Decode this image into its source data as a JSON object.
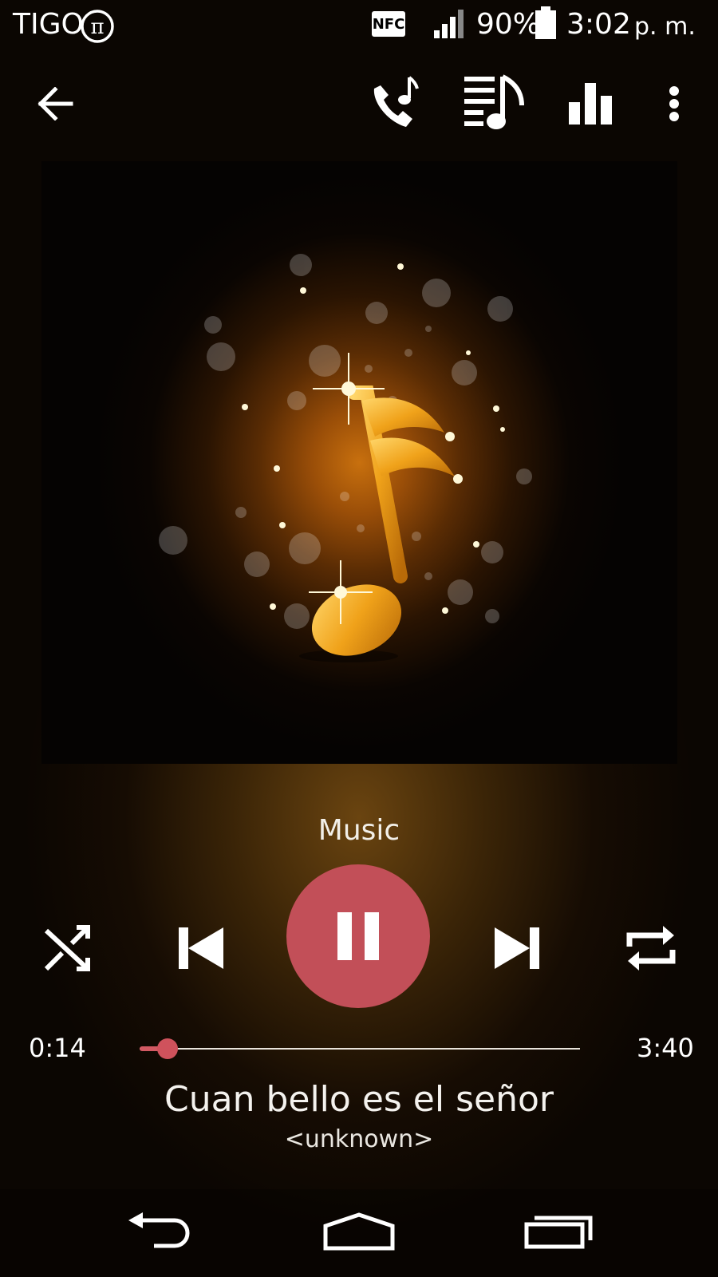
{
  "status_bar": {
    "carrier": "TIGO",
    "carrier_icon": "pi-circle-icon",
    "nfc": "NFC",
    "battery": "90%",
    "time": "3:02",
    "ampm": "p. m."
  },
  "action_bar": {
    "icons": [
      "back-arrow-icon",
      "call-ringtone-icon",
      "playlist-icon",
      "equalizer-icon",
      "overflow-menu-icon"
    ]
  },
  "player": {
    "source_label": "Music",
    "elapsed": "0:14",
    "total": "3:40",
    "progress_fraction": 0.064,
    "title": "Cuan bello es el señor",
    "artist": "<unknown>",
    "accent_color": "#c24f58"
  },
  "navigation": {
    "icons": [
      "nav-back-icon",
      "nav-home-icon",
      "nav-recents-icon"
    ]
  }
}
